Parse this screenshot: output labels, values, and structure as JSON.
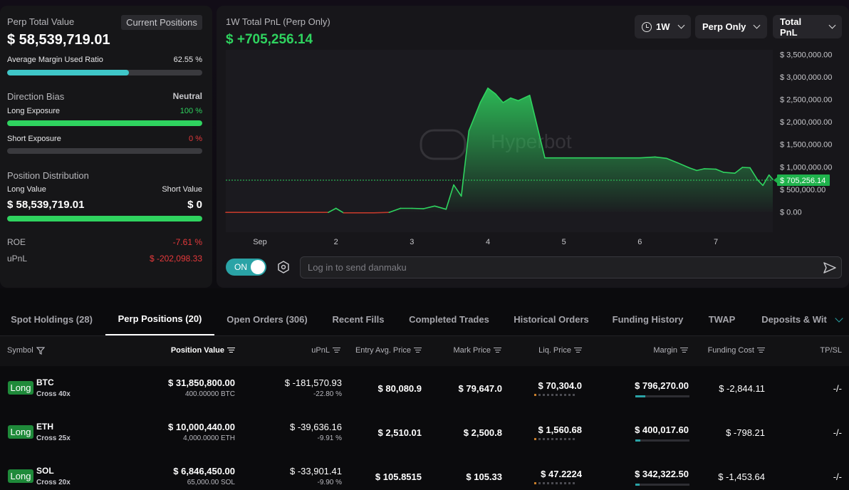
{
  "overview": {
    "perp_total_value_label": "Perp Total Value",
    "perp_total_value": "$ 58,539,719.01",
    "current_positions_button": "Current Positions",
    "avg_margin_label": "Average Margin Used Ratio",
    "avg_margin_value": "62.55 %",
    "avg_margin_ratio": 0.6255,
    "direction_bias_label": "Direction Bias",
    "direction_bias_value": "Neutral",
    "long_exposure_label": "Long Exposure",
    "long_exposure_value": "100 %",
    "long_exposure_ratio": 1.0,
    "short_exposure_label": "Short Exposure",
    "short_exposure_value": "0 %",
    "short_exposure_ratio": 0.0,
    "position_distribution_label": "Position Distribution",
    "long_value_label": "Long Value",
    "short_value_label": "Short Value",
    "long_value": "$ 58,539,719.01",
    "short_value": "$ 0",
    "long_value_ratio": 1.0,
    "roe_label": "ROE",
    "roe_value": "-7.61 %",
    "upnl_label": "uPnL",
    "upnl_value": "$ -202,098.33",
    "colors": {
      "green": "#2fd35f",
      "red": "#e5393b",
      "teal": "#2aa3a6"
    }
  },
  "chart_panel": {
    "title": "1W Total PnL (Perp Only)",
    "value": "$ +705,256.14",
    "range_button": "1W",
    "scope_button": "Perp Only",
    "metric_button": "Total PnL",
    "watermark": "Hyperbot",
    "toggle_label": "ON",
    "danmaku_placeholder": "Log in to send danmaku"
  },
  "chart_data": {
    "type": "area",
    "title": "1W Total PnL (Perp Only)",
    "x_ticks": [
      "Sep",
      "2",
      "3",
      "4",
      "5",
      "6",
      "7"
    ],
    "y_ticks": [
      "$ 3,500,000.00",
      "$ 3,000,000.00",
      "$ 2,500,000.00",
      "$ 2,000,000.00",
      "$ 1,500,000.00",
      "$ 1,000,000.00",
      "$ 500,000.00",
      "$ 0.00"
    ],
    "y_tick_values": [
      3500000,
      3000000,
      2500000,
      2000000,
      1500000,
      1000000,
      500000,
      0
    ],
    "ylim": [
      -450000,
      3600000
    ],
    "xlim": [
      0.55,
      7.75
    ],
    "current_label": "$ 705,256.14",
    "current_value": 705256.14,
    "series": [
      {
        "points": [
          [
            0.55,
            -10000
          ],
          [
            1.0,
            -10000
          ],
          [
            1.5,
            -10000
          ],
          [
            1.9,
            -10000
          ],
          [
            2.0,
            80000
          ],
          [
            2.1,
            -20000
          ],
          [
            2.3,
            -20000
          ],
          [
            2.5,
            -20000
          ],
          [
            2.7,
            -10000
          ],
          [
            2.85,
            80000
          ],
          [
            3.0,
            80000
          ],
          [
            3.15,
            70000
          ],
          [
            3.3,
            130000
          ],
          [
            3.45,
            60000
          ],
          [
            3.55,
            600000
          ],
          [
            3.65,
            350000
          ],
          [
            3.75,
            1800000
          ],
          [
            3.9,
            2430000
          ],
          [
            4.0,
            2750000
          ],
          [
            4.1,
            2620000
          ],
          [
            4.2,
            2430000
          ],
          [
            4.3,
            2530000
          ],
          [
            4.4,
            2470000
          ],
          [
            4.55,
            2590000
          ],
          [
            4.75,
            1200000
          ],
          [
            5.0,
            1200000
          ],
          [
            5.5,
            1200000
          ],
          [
            6.0,
            1200000
          ],
          [
            6.2,
            1220000
          ],
          [
            6.35,
            1190000
          ],
          [
            6.5,
            1090000
          ],
          [
            6.65,
            980000
          ],
          [
            6.75,
            920000
          ],
          [
            6.85,
            960000
          ],
          [
            7.0,
            950000
          ],
          [
            7.1,
            880000
          ],
          [
            7.25,
            860000
          ],
          [
            7.35,
            990000
          ],
          [
            7.45,
            980000
          ],
          [
            7.55,
            710000
          ],
          [
            7.62,
            590000
          ],
          [
            7.7,
            820000
          ],
          [
            7.75,
            720000
          ]
        ]
      }
    ],
    "grid": false
  },
  "tabs": [
    "Spot Holdings (28)",
    "Perp Positions (20)",
    "Open Orders (306)",
    "Recent Fills",
    "Completed Trades",
    "Historical Orders",
    "Funding History",
    "TWAP",
    "Deposits & Wit"
  ],
  "active_tab_index": 1,
  "table": {
    "headers": {
      "symbol": "Symbol",
      "position_value": "Position Value",
      "upnl": "uPnL",
      "entry": "Entry Avg. Price",
      "mark": "Mark Price",
      "liq": "Liq. Price",
      "margin": "Margin",
      "funding": "Funding Cost",
      "tpsl": "TP/SL"
    },
    "rows": [
      {
        "side": "Long",
        "symbol": "BTC",
        "leverage": "Cross 40x",
        "position_value": "$ 31,850,800.00",
        "position_size": "400.00000 BTC",
        "upnl": "$ -181,570.93",
        "upnl_pct": "-22.80 %",
        "entry": "$ 80,080.9",
        "mark": "$ 79,647.0",
        "liq": "$ 70,304.0",
        "liq_level": 1,
        "margin": "$ 796,270.00",
        "margin_ratio": 0.18,
        "funding": "$ -2,844.11",
        "tpsl": "-/-"
      },
      {
        "side": "Long",
        "symbol": "ETH",
        "leverage": "Cross 25x",
        "position_value": "$ 10,000,440.00",
        "position_size": "4,000.0000 ETH",
        "upnl": "$ -39,636.16",
        "upnl_pct": "-9.91 %",
        "entry": "$ 2,510.01",
        "mark": "$ 2,500.8",
        "liq": "$ 1,560.68",
        "liq_level": 1,
        "margin": "$ 400,017.60",
        "margin_ratio": 0.09,
        "funding": "$ -798.21",
        "tpsl": "-/-"
      },
      {
        "side": "Long",
        "symbol": "SOL",
        "leverage": "Cross 20x",
        "position_value": "$ 6,846,450.00",
        "position_size": "65,000.00 SOL",
        "upnl": "$ -33,901.41",
        "upnl_pct": "-9.90 %",
        "entry": "$ 105.8515",
        "mark": "$ 105.33",
        "liq": "$ 47.2224",
        "liq_level": 1,
        "margin": "$ 342,322.50",
        "margin_ratio": 0.08,
        "funding": "$ -1,453.64",
        "tpsl": "-/-"
      }
    ]
  }
}
